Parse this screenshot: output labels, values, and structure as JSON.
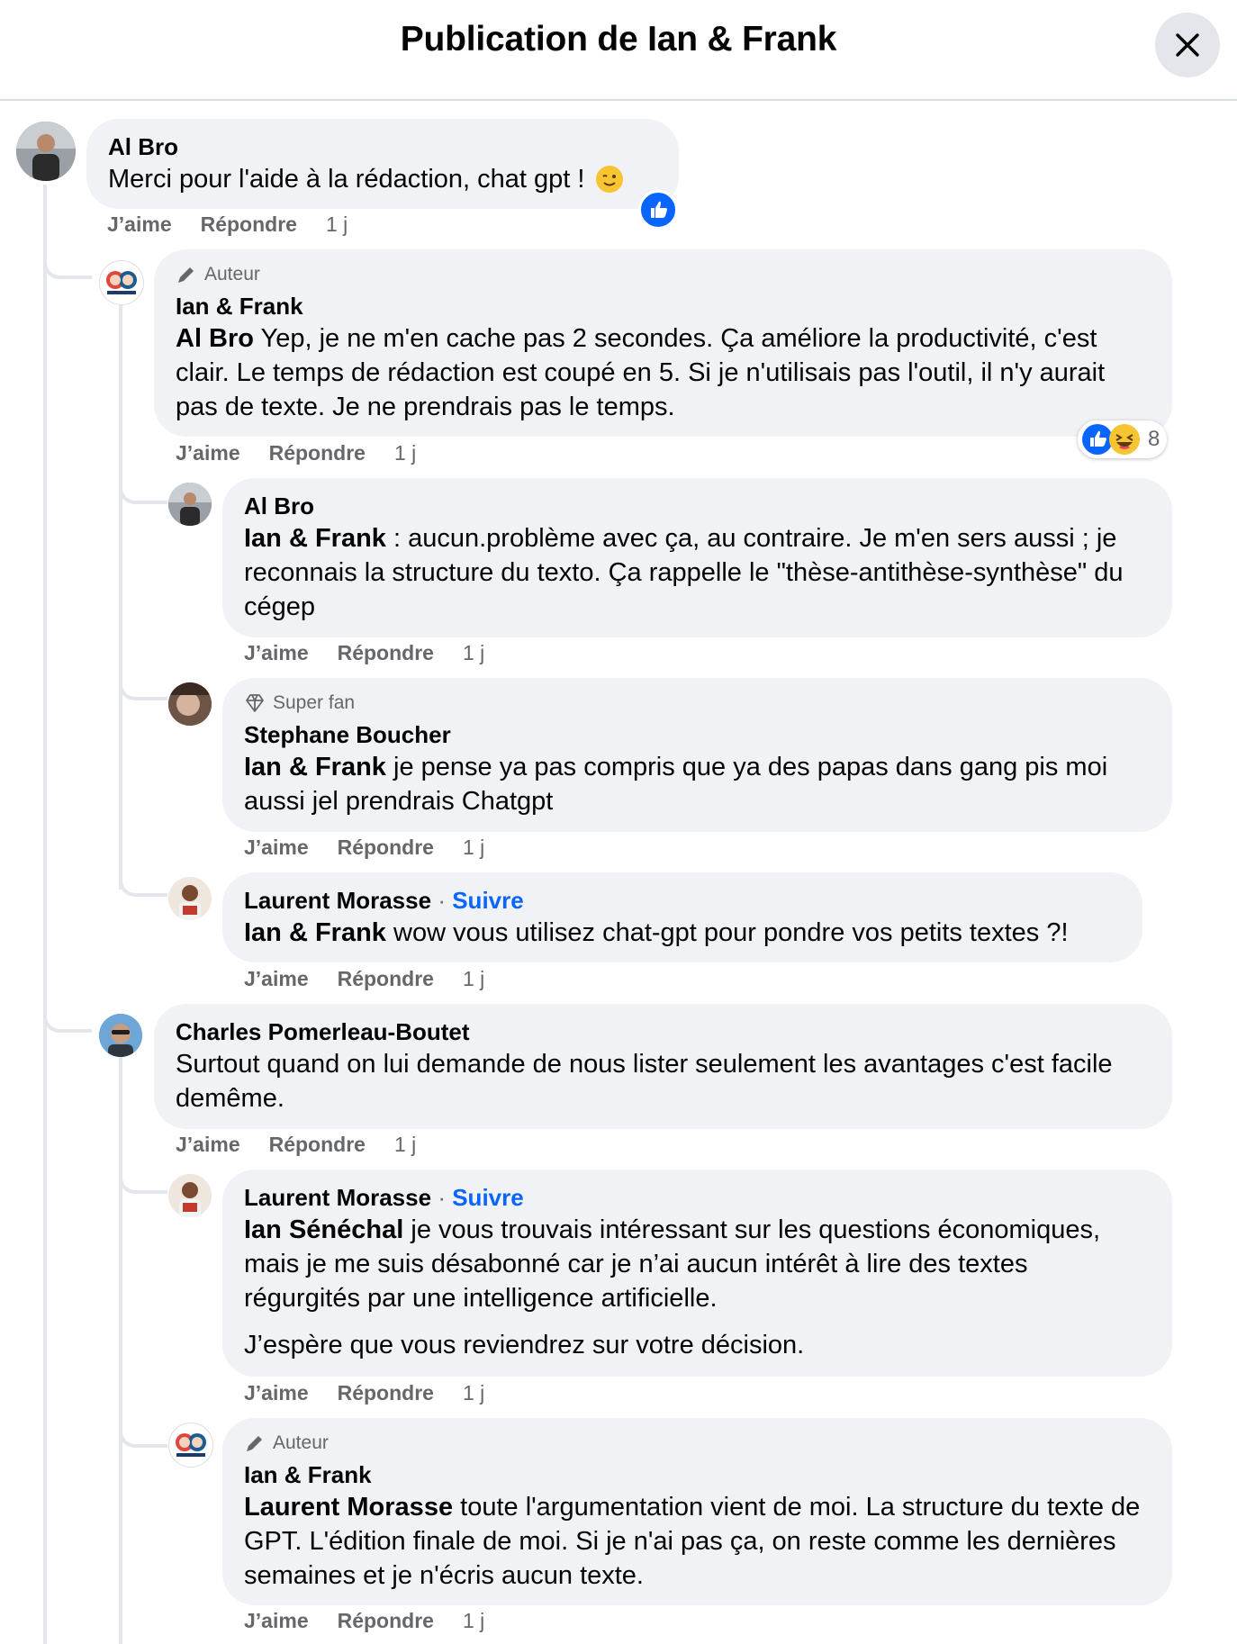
{
  "header": {
    "title": "Publication de Ian & Frank"
  },
  "labels": {
    "like": "J’aime",
    "reply": "Répondre",
    "follow": "Suivre",
    "sep": "·"
  },
  "comments": [
    {
      "author": "Al Bro",
      "text": "Merci pour l'aide à la rédaction, chat gpt ! ",
      "time": "1 j"
    },
    {
      "badge": "Auteur",
      "author": "Ian & Frank",
      "mention": "Al Bro",
      "text": " Yep, je ne m'en cache pas 2 secondes. Ça améliore la productivité, c'est clair. Le temps de rédaction est coupé en 5. Si je n'utilisais pas l'outil, il n'y aurait pas de texte. Je ne prendrais pas le temps.",
      "time": "1 j",
      "reaction_count": "8"
    },
    {
      "author": "Al Bro",
      "mention": "Ian & Frank",
      "text": " : aucun.problème avec ça, au contraire. Je m'en sers aussi ; je reconnais la structure du texto. Ça rappelle le \"thèse-antithèse-synthèse\" du cégep",
      "time": "1 j"
    },
    {
      "badge": "Super fan",
      "author": "Stephane Boucher",
      "mention": "Ian & Frank",
      "text": " je pense ya pas compris que ya des papas dans gang pis moi aussi jel prendrais Chatgpt",
      "time": "1 j"
    },
    {
      "author": "Laurent Morasse",
      "mention": "Ian & Frank",
      "text": " wow vous utilisez chat-gpt pour pondre vos petits textes ?!",
      "time": "1 j"
    },
    {
      "author": "Charles Pomerleau-Boutet",
      "text": "Surtout quand on lui demande de nous lister seulement les avantages c'est facile demême.",
      "time": "1 j"
    },
    {
      "author": "Laurent Morasse",
      "mention": "Ian Sénéchal",
      "text": " je vous trouvais intéressant sur les questions économiques, mais je me suis désabonné car je n’ai aucun intérêt à lire des textes régurgités par une intelligence artificielle.",
      "text2": "J’espère que vous reviendrez sur votre décision.",
      "time": "1 j"
    },
    {
      "badge": "Auteur",
      "author": "Ian & Frank",
      "mention": "Laurent Morasse",
      "text": " toute l'argumentation vient de moi. La structure du texte de GPT. L'édition finale de moi. Si je n'ai pas ça, on reste comme les dernières semaines et je n'écris aucun texte.",
      "time": "1 j"
    }
  ],
  "colors": {
    "bubble": "#f0f2f5",
    "link": "#0866ff",
    "secondary": "#65676b",
    "line": "#e4e6eb"
  }
}
